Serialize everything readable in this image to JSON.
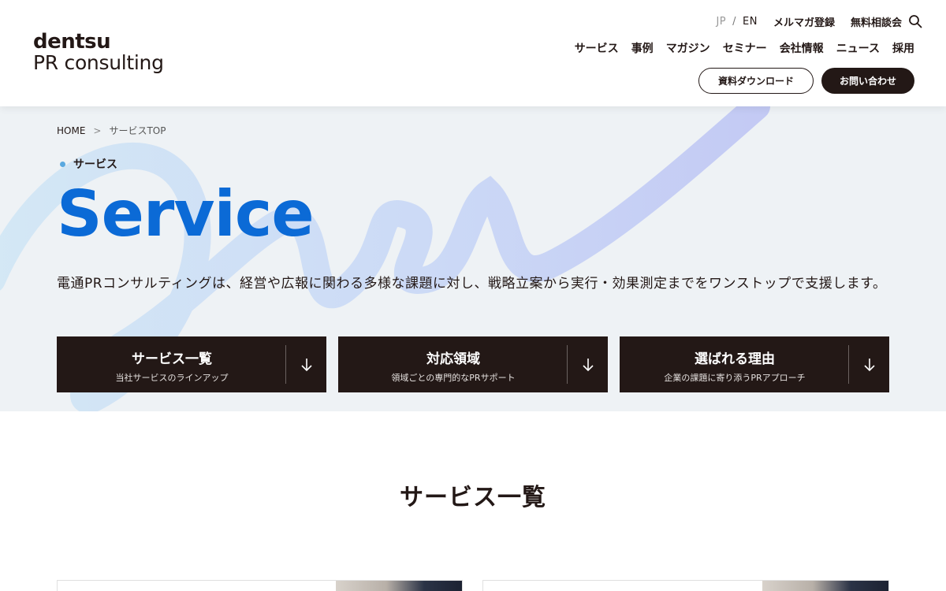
{
  "logo": {
    "top": "dentsu",
    "bottom": "PR consulting"
  },
  "utility": {
    "lang_jp": "JP",
    "lang_sep": "/",
    "lang_en": "EN",
    "newsletter": "メルマガ登録",
    "consultation": "無料相談会"
  },
  "nav": {
    "items": [
      "サービス",
      "事例",
      "マガジン",
      "セミナー",
      "会社情報",
      "ニュース",
      "採用"
    ]
  },
  "buttons": {
    "download": "資料ダウンロード",
    "contact": "お問い合わせ"
  },
  "breadcrumb": {
    "home": "HOME",
    "chevron": ">",
    "current": "サービスTOP"
  },
  "hero": {
    "eyebrow": "サービス",
    "title": "Service",
    "description": "電通PRコンサルティングは、経営や広報に関わる多様な課題に対し、戦略立案から実行・効果測定までをワンストップで支援します。"
  },
  "cards": [
    {
      "title": "サービス一覧",
      "subtitle": "当社サービスのラインアップ"
    },
    {
      "title": "対応領域",
      "subtitle": "領域ごとの専門的なPRサポート"
    },
    {
      "title": "選ばれる理由",
      "subtitle": "企業の課題に寄り添うPRアプローチ"
    }
  ],
  "section": {
    "title": "サービス一覧"
  },
  "colors": {
    "accent_blue": "#0b6ad6",
    "dark": "#231816",
    "hero_bg": "#eef2f5",
    "dot": "#5aa9e0"
  },
  "icons": {
    "search": "search-icon",
    "arrow": "arrow-down-icon",
    "chevron": "chevron-right-icon"
  }
}
